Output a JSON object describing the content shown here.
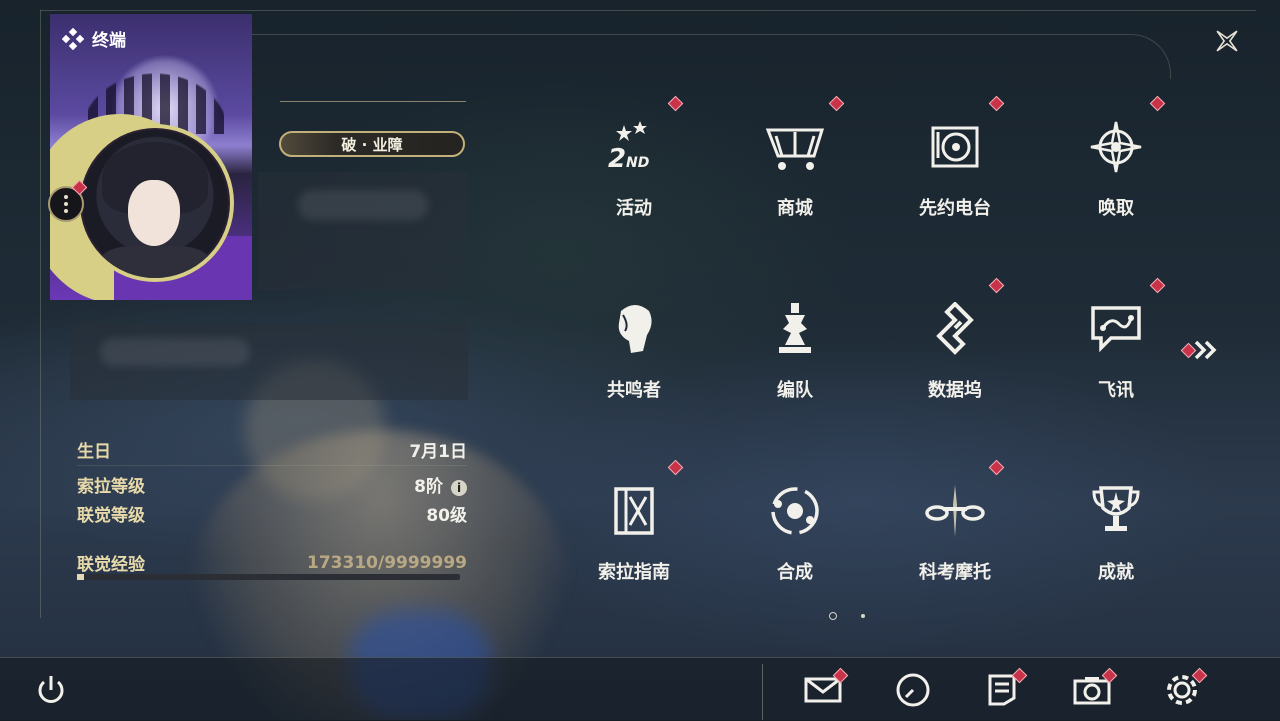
{
  "profile": {
    "header": "终端",
    "title_badge": "破 · 业障"
  },
  "stats": {
    "birthday_label": "生日",
    "birthday_value": "7月1日",
    "sola_rank_label": "索拉等级",
    "sola_rank_value": "8阶",
    "union_level_label": "联觉等级",
    "union_level_value": "80级",
    "union_exp_label": "联觉经验",
    "union_exp_value": "173310/9999999",
    "union_exp_fraction": 0.0173
  },
  "menu": {
    "row1": [
      {
        "label": "活动",
        "icon": "event-2nd-icon",
        "badge": true
      },
      {
        "label": "商城",
        "icon": "shop-basket-icon",
        "badge": true
      },
      {
        "label": "先约电台",
        "icon": "radio-turntable-icon",
        "badge": true
      },
      {
        "label": "唤取",
        "icon": "convene-star-icon",
        "badge": true
      }
    ],
    "row2": [
      {
        "label": "共鸣者",
        "icon": "resonator-head-icon",
        "badge": false
      },
      {
        "label": "编队",
        "icon": "team-chess-icon",
        "badge": false
      },
      {
        "label": "数据坞",
        "icon": "data-bank-icon",
        "badge": true
      },
      {
        "label": "飞讯",
        "icon": "message-bubble-icon",
        "badge": true
      }
    ],
    "row3": [
      {
        "label": "索拉指南",
        "icon": "guide-book-icon",
        "badge": true
      },
      {
        "label": "合成",
        "icon": "synthesis-orbit-icon",
        "badge": false
      },
      {
        "label": "科考摩托",
        "icon": "motorbike-icon",
        "badge": true
      },
      {
        "label": "成就",
        "icon": "trophy-icon",
        "badge": false
      }
    ]
  },
  "bottom_bar": [
    "power-icon",
    "mail-icon",
    "clock-icon",
    "notes-icon",
    "camera-icon",
    "settings-gear-icon"
  ],
  "colors": {
    "accent_gold": "#d8cf86",
    "badge_red": "#c8334a",
    "text_gold": "#e7d9a9"
  }
}
